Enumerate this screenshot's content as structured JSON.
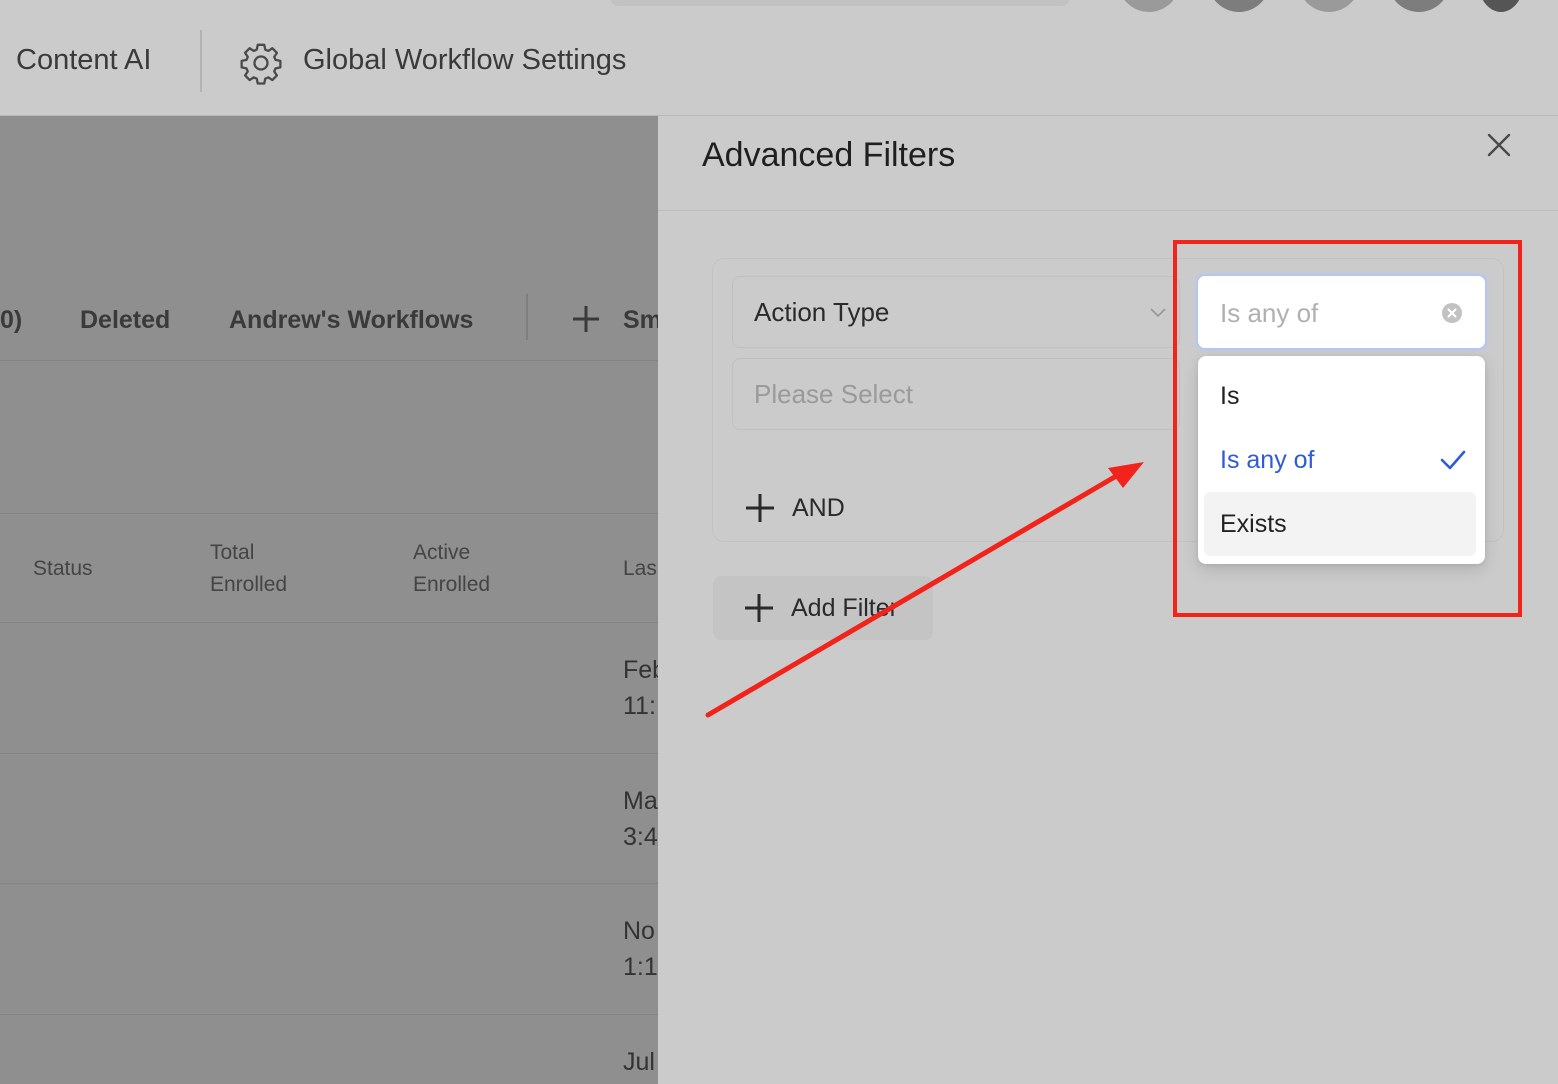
{
  "header": {
    "product_label": "Content AI",
    "settings_label": "Global Workflow Settings"
  },
  "background": {
    "tabs": [
      "0)",
      "Deleted",
      "Andrew's Workflows",
      "Sm"
    ],
    "columns": {
      "status": "Status",
      "total_enrolled": [
        "Total",
        "Enrolled"
      ],
      "active_enrolled": [
        "Active",
        "Enrolled"
      ],
      "last": "Las"
    },
    "rows": [
      [
        "Feb",
        "11:"
      ],
      [
        "Ma",
        "3:4"
      ],
      [
        "No",
        "1:1"
      ],
      [
        "Jul",
        ""
      ]
    ]
  },
  "panel": {
    "title": "Advanced Filters",
    "field_select": {
      "value": "Action Type"
    },
    "value_select": {
      "placeholder": "Please Select"
    },
    "operator_select": {
      "placeholder": "Is any of"
    },
    "operator_options": [
      {
        "label": "Is",
        "selected": false,
        "hovered": false
      },
      {
        "label": "Is any of",
        "selected": true,
        "hovered": false
      },
      {
        "label": "Exists",
        "selected": false,
        "hovered": true
      }
    ],
    "and_label": "AND",
    "add_filter_label": "Add Filter"
  },
  "colors": {
    "annotation_red": "#f1231a",
    "selected_option": "#2f5bd6",
    "overlay_dim": "#8f8f8f"
  }
}
